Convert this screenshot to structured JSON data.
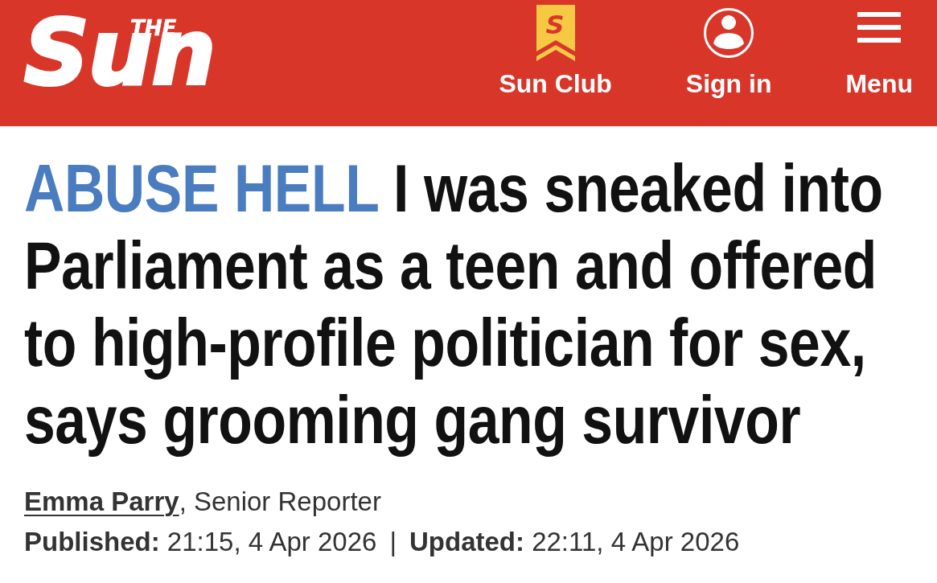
{
  "masthead": {
    "logo": {
      "small": "THE",
      "main": "Sun"
    },
    "nav": [
      {
        "kind": "club",
        "badge_text": "S",
        "label": "Sun Club"
      },
      {
        "kind": "account",
        "label": "Sign in"
      },
      {
        "kind": "menu",
        "label": "Menu"
      }
    ]
  },
  "headline": {
    "kicker": "ABUSE HELL",
    "title": "I was sneaked into Parliament as a teen and offered to high-profile politician for sex, says grooming gang survivor"
  },
  "byline": {
    "author": "Emma Parry",
    "role": ", Senior Reporter"
  },
  "timestamps": [
    "**Published:** 21:15, 4 Apr 2026",
    "**Updated:** 22:11, 4 Apr 2026"
  ],
  "timestamp_separator": "|"
}
